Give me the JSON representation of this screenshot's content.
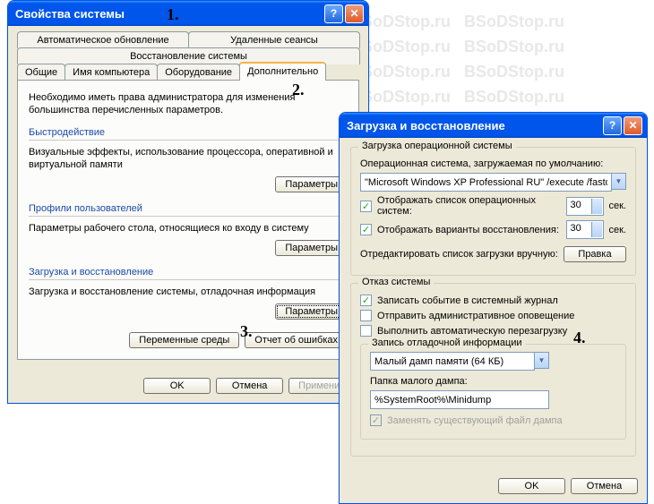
{
  "watermark_text": "BSoDStop.ru BSoDStop.ru BSoDStop.ru BSoDStop.ru BSoDStop.ru BSoDStop.ru BSoDStop.ru BSoDStop.ru BSoDStop.ru BSoDStop.ru BSoDStop.ru BSoDStop.ru BSoDStop.ru BSoDStop.ru BSoDStop.ru BSoDStop.ru BSoDStop.ru BSoDStop.ru BSoDStop.ru BSoDStop.ru BSoDStop.ru BSoDStop.ru BSoDStop.ru BSoDStop.ru BSoDStop.ru BSoDStop.ru BSoDStop.ru BSoDStop.ru BSoDStop.ru BSoDStop.ru BSoDStop.ru BSoDStop.ru BSoDStop.ru BSoDStop.ru BSoDStop.ru BSoDStop.ru BSoDStop.ru BSoDStop.ru BSoDStop.ru BSoDStop.ru BSoDStop.ru BSoDStop.ru BSoDStop.ru BSoDStop.ru BSoDStop.ru BSoDStop.ru BSoDStop.ru BSoDStop.ru BSoDStop.ru BSoDStop.ru BSoDStop.ru BSoDStop.ru BSoDStop.ru BSoDStop.ru BSoDStop.ru BSoDStop.ru BSoDStop.ru BSoDStop.ru BSoDStop.ru BSoDStop.ru",
  "annotations": {
    "a1": "1.",
    "a2": "2.",
    "a3": "3.",
    "a4": "4."
  },
  "win1": {
    "title": "Свойства системы",
    "tabs_row1": [
      "Автоматическое обновление",
      "Удаленные сеансы"
    ],
    "tabs_row2_restore": "Восстановление системы",
    "tabs_row3": [
      "Общие",
      "Имя компьютера",
      "Оборудование",
      "Дополнительно"
    ],
    "intro": "Необходимо иметь права администратора для изменения большинства перечисленных параметров.",
    "perf": {
      "title": "Быстродействие",
      "desc": "Визуальные эффекты, использование процессора, оперативной и виртуальной памяти",
      "button": "Параметры"
    },
    "profiles": {
      "title": "Профили пользователей",
      "desc": "Параметры рабочего стола, относящиеся ко входу в систему",
      "button": "Параметры"
    },
    "startup": {
      "title": "Загрузка и восстановление",
      "desc": "Загрузка и восстановление системы, отладочная информация",
      "button": "Параметры"
    },
    "env_btn": "Переменные среды",
    "err_btn": "Отчет об ошибках",
    "ok": "OK",
    "cancel": "Отмена",
    "apply": "Применить"
  },
  "win2": {
    "title": "Загрузка и восстановление",
    "boot": {
      "legend": "Загрузка операционной системы",
      "default_label": "Операционная система, загружаемая по умолчанию:",
      "default_value": "\"Microsoft Windows XP Professional RU\" /execute /fastdetect /us",
      "show_list": "Отображать список операционных систем:",
      "show_list_val": "30",
      "show_list_unit": "сек.",
      "show_recovery": "Отображать варианты восстановления:",
      "show_recovery_val": "30",
      "show_recovery_unit": "сек.",
      "edit_label": "Отредактировать список загрузки вручную:",
      "edit_btn": "Правка"
    },
    "failure": {
      "legend": "Отказ системы",
      "write_event": "Записать событие в системный журнал",
      "send_alert": "Отправить административное оповещение",
      "auto_restart": "Выполнить автоматическую перезагрузку",
      "debug_legend": "Запись отладочной информации",
      "dump_type": "Малый дамп памяти (64 КБ)",
      "dump_folder_label": "Папка малого дампа:",
      "dump_folder": "%SystemRoot%\\Minidump",
      "overwrite": "Заменять существующий файл дампа"
    },
    "ok": "OK",
    "cancel": "Отмена"
  }
}
